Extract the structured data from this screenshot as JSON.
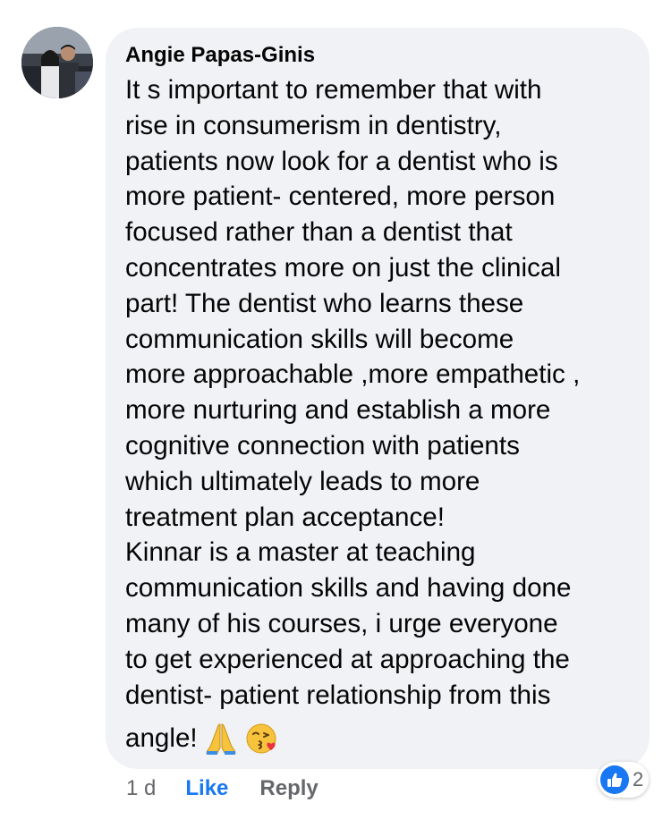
{
  "comment": {
    "author": "Angie Papas-Ginis",
    "lines": [
      "It s important to remember that with",
      "rise in consumerism in dentistry,",
      "patients now look for a dentist who is",
      "more patient- centered, more person",
      "focused rather than a dentist that",
      "concentrates more on just the clinical",
      "part! The dentist who learns these",
      "communication skills will become",
      "more approachable ,more empathetic ,",
      "more nurturing and establish a more",
      "cognitive connection with patients",
      "which ultimately leads to more",
      "treatment plan acceptance!",
      "Kinnar is a master at teaching",
      "communication skills and having done",
      "many of his courses, i urge everyone",
      "to get experienced at approaching the",
      "dentist- patient relationship from this"
    ],
    "last_line": "angle!",
    "emojis": [
      "folded-hands-icon",
      "kissing-face-icon"
    ]
  },
  "actions": {
    "timestamp": "1 d",
    "like_label": "Like",
    "reply_label": "Reply"
  },
  "reactions": {
    "icon": "thumbs-up-icon",
    "count": "2"
  },
  "colors": {
    "bubble": "#f0f2f5",
    "like_blue": "#1877f2",
    "secondary_text": "#65676b"
  }
}
